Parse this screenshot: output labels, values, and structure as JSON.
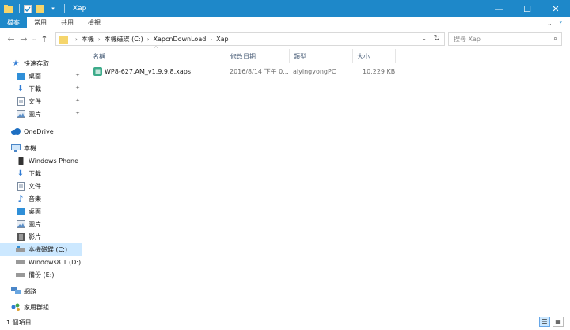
{
  "window": {
    "title": "Xap",
    "minimize": "—",
    "maximize": "☐",
    "close": "✕"
  },
  "ribbon": {
    "tabs": [
      "檔案",
      "常用",
      "共用",
      "檢視"
    ]
  },
  "address": {
    "crumbs": [
      "本機",
      "本機磁碟 (C:)",
      "XapcnDownLoad",
      "Xap"
    ]
  },
  "search": {
    "placeholder": "搜尋 Xap"
  },
  "sidebar": {
    "items": [
      {
        "label": "快速存取",
        "icon": "star-icon"
      },
      {
        "label": "桌面",
        "icon": "desktop-icon",
        "pinned": true
      },
      {
        "label": "下載",
        "icon": "download-icon",
        "pinned": true
      },
      {
        "label": "文件",
        "icon": "document-icon",
        "pinned": true
      },
      {
        "label": "圖片",
        "icon": "picture-icon",
        "pinned": true
      },
      {
        "label": "OneDrive",
        "icon": "cloud-icon"
      },
      {
        "label": "本機",
        "icon": "computer-icon"
      },
      {
        "label": "Windows Phone",
        "icon": "phone-icon"
      },
      {
        "label": "下載",
        "icon": "download-icon"
      },
      {
        "label": "文件",
        "icon": "document-icon"
      },
      {
        "label": "音樂",
        "icon": "music-icon"
      },
      {
        "label": "桌面",
        "icon": "desktop-icon"
      },
      {
        "label": "圖片",
        "icon": "picture-icon"
      },
      {
        "label": "影片",
        "icon": "video-icon"
      },
      {
        "label": "本機磁碟 (C:)",
        "icon": "drive-icon",
        "selected": true
      },
      {
        "label": "Windows8.1 (D:)",
        "icon": "drive-icon"
      },
      {
        "label": "備份 (E:)",
        "icon": "drive-icon"
      },
      {
        "label": "網路",
        "icon": "network-icon"
      },
      {
        "label": "家用群組",
        "icon": "homegroup-icon"
      }
    ]
  },
  "columns": {
    "name": "名稱",
    "date": "修改日期",
    "type": "類型",
    "size": "大小"
  },
  "files": [
    {
      "name": "WP8-627.AM_v1.9.9.8.xaps",
      "date": "2016/8/14 下午 0...",
      "type": "aiyingyongPC",
      "size": "10,229 KB"
    }
  ],
  "status": {
    "count": "1 個項目"
  },
  "colors": {
    "accent": "#1e88c9",
    "selection": "#cce8ff"
  }
}
